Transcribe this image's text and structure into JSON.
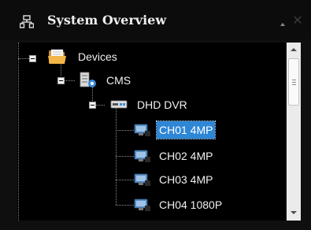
{
  "panel": {
    "title": "System Overview",
    "title_icon": "network-icon",
    "collapse_icon": "collapse-up-icon",
    "close_icon": "close-icon"
  },
  "tree": {
    "root": {
      "label": "Devices",
      "icon": "folder-icon",
      "expanded": true
    },
    "cms": {
      "label": "CMS",
      "icon": "cms-server-icon",
      "expanded": true
    },
    "dvr": {
      "label": "DHD DVR",
      "icon": "dvr-device-icon",
      "expanded": true
    },
    "channels": [
      {
        "label": "CH01 4MP",
        "icon": "camera-channel-icon",
        "selected": true
      },
      {
        "label": "CH02 4MP",
        "icon": "camera-channel-icon",
        "selected": false
      },
      {
        "label": "CH03 4MP",
        "icon": "camera-channel-icon",
        "selected": false
      },
      {
        "label": "CH04 1080P",
        "icon": "camera-channel-icon",
        "selected": false
      }
    ]
  },
  "colors": {
    "panel_bg": "#0c0c0c",
    "tree_bg": "#000000",
    "selection": "#2e86d6",
    "scrollbar": "#ebebeb"
  }
}
